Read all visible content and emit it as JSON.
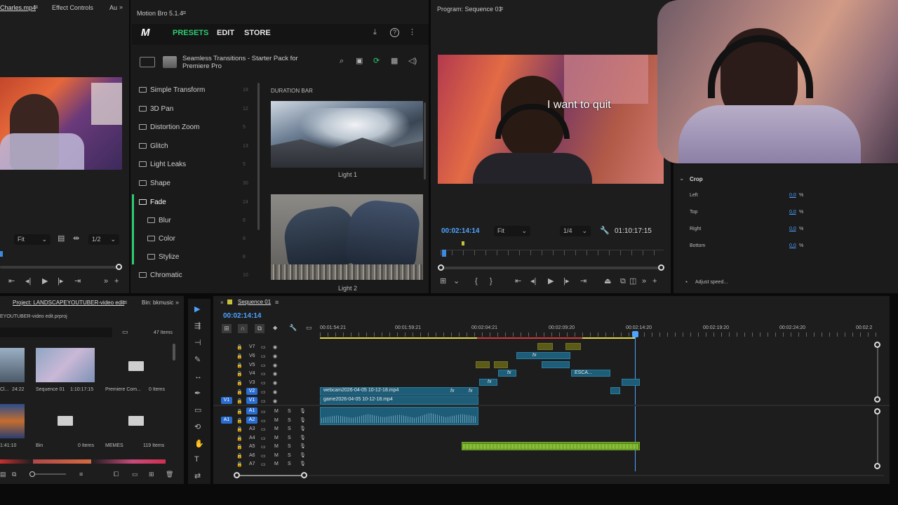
{
  "source_panel": {
    "tabs": [
      "Charles.mp4",
      "Effect Controls",
      "Au"
    ],
    "fit_label": "Fit",
    "res_label": "1/2"
  },
  "motion_bro": {
    "title": "Motion Bro 5.1.4",
    "nav": [
      "PRESETS",
      "EDIT",
      "STORE"
    ],
    "pack_name_line1": "Seamless Transitions - Starter Pack for",
    "pack_name_line2": "Premiere Pro",
    "categories": [
      {
        "label": "Simple Transform",
        "count": "18"
      },
      {
        "label": "3D Pan",
        "count": "12"
      },
      {
        "label": "Distortion Zoom",
        "count": "5"
      },
      {
        "label": "Glitch",
        "count": "13"
      },
      {
        "label": "Light Leaks",
        "count": "5"
      },
      {
        "label": "Shape",
        "count": "30"
      },
      {
        "label": "Fade",
        "count": "24"
      },
      {
        "label": "Blur",
        "count": "8"
      },
      {
        "label": "Color",
        "count": "8"
      },
      {
        "label": "Stylize",
        "count": "8"
      },
      {
        "label": "Chromatic",
        "count": "10"
      }
    ],
    "breadcrumb": "DURATION BAR",
    "previews": [
      "Light 1",
      "Light 2"
    ],
    "accent": "#2ecc71"
  },
  "program": {
    "title": "Program: Sequence 01",
    "caption": "I want to quit",
    "timecode": "00:02:14:14",
    "fit_label": "Fit",
    "res_label": "1/4",
    "duration": "01:10:17:15"
  },
  "crop": {
    "title": "Crop",
    "rows": [
      {
        "label": "Left",
        "value": "0,0",
        "unit": "%"
      },
      {
        "label": "Top",
        "value": "0,0",
        "unit": "%"
      },
      {
        "label": "Right",
        "value": "0,0",
        "unit": "%"
      },
      {
        "label": "Bottom",
        "value": "0,0",
        "unit": "%"
      }
    ],
    "adjust_speed": "Adjust speed..."
  },
  "project": {
    "tab": "Project: LANDSCAPEYOUTUBER-video edit",
    "bin_tab": "Bin: bkmusic",
    "file": "EYOUTUBER-video edit.prproj",
    "item_count": "47 Items",
    "items": [
      {
        "name": "Cl...",
        "meta": "24:22"
      },
      {
        "name": "Sequence 01",
        "meta": "1:10:17:15"
      },
      {
        "name": "Premiere Com...",
        "meta": "0 Items"
      },
      {
        "name": "",
        "meta": "1:41:10"
      },
      {
        "name": "Bin",
        "meta": "0 Items"
      },
      {
        "name": "MEMES",
        "meta": "119 Items"
      }
    ]
  },
  "timeline": {
    "tab": "Sequence 01",
    "timecode": "00:02:14:14",
    "ruler": [
      "00:01:54:21",
      "00:01:59:21",
      "00:02:04:21",
      "00:02:09:20",
      "00:02:14:20",
      "00:02:19:20",
      "00:02:24:20",
      "00:02:2"
    ],
    "video_tracks": [
      "V7",
      "V6",
      "V5",
      "V4",
      "V3",
      "V2",
      "V1"
    ],
    "audio_tracks": [
      "A1",
      "A2",
      "A3",
      "A4",
      "A5",
      "A6",
      "A7"
    ],
    "clip_v2": "webcam2026-04-05 10-12-18.mp4",
    "clip_v1": "game2026-04-05 10-12-18.mp4",
    "clip_esca": "ESCA...",
    "fx": "fx",
    "v1_source": "V1",
    "a1_source": "A1",
    "m_label": "M",
    "s_label": "S"
  }
}
